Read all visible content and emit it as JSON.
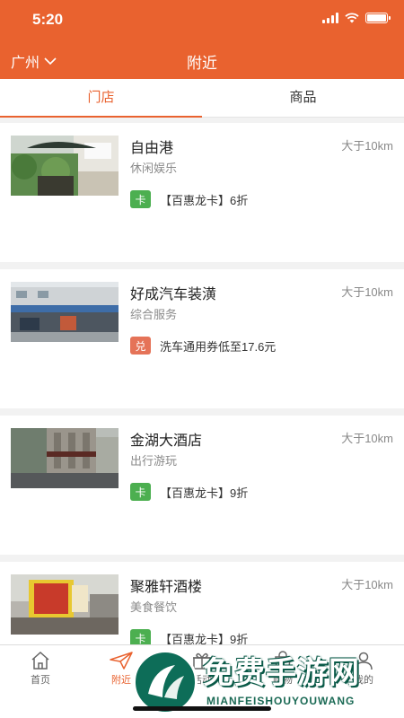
{
  "status_bar": {
    "time": "5:20"
  },
  "nav": {
    "city": "广州",
    "title": "附近"
  },
  "tabs": [
    {
      "label": "门店",
      "active": true
    },
    {
      "label": "商品",
      "active": false
    }
  ],
  "stores": [
    {
      "name": "自由港",
      "distance": "大于10km",
      "category": "休闲娱乐",
      "badge": "卡",
      "badge_type": "card",
      "offer": "【百惠龙卡】6折"
    },
    {
      "name": "好成汽车装潢",
      "distance": "大于10km",
      "category": "综合服务",
      "badge": "兑",
      "badge_type": "exchange",
      "offer": "洗车通用券低至17.6元"
    },
    {
      "name": "金湖大酒店",
      "distance": "大于10km",
      "category": "出行游玩",
      "badge": "卡",
      "badge_type": "card",
      "offer": "【百惠龙卡】9折"
    },
    {
      "name": "聚雅轩酒楼",
      "distance": "大于10km",
      "category": "美食餐饮",
      "badge": "卡",
      "badge_type": "card",
      "offer": "【百惠龙卡】9折"
    }
  ],
  "tabbar": {
    "items": [
      {
        "label": "首页",
        "icon": "home-icon",
        "active": false
      },
      {
        "label": "附近",
        "icon": "send-icon",
        "active": true
      },
      {
        "label": "活动",
        "icon": "gift-icon",
        "active": false
      },
      {
        "label": "购物",
        "icon": "bag-icon",
        "active": false
      },
      {
        "label": "我的",
        "icon": "user-icon",
        "active": false
      }
    ]
  },
  "watermark": {
    "title": "免费手游网",
    "subtitle": "MIANFEISHOUYOUWANG"
  },
  "colors": {
    "brand": "#e9622f",
    "card_badge": "#4caf50",
    "exchange_badge": "#e57358"
  }
}
